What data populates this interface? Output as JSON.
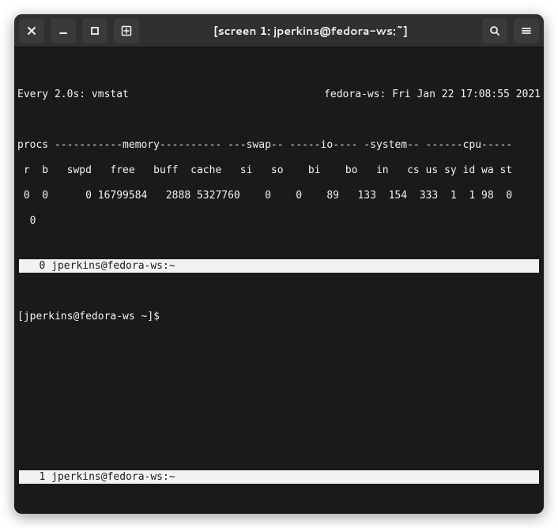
{
  "titlebar": {
    "title": "[screen 1: jperkins@fedora-ws:~]"
  },
  "top_pane": {
    "header_left": "Every 2.0s: vmstat",
    "header_right": "fedora-ws: Fri Jan 22 17:08:55 2021",
    "hdr1": "procs -----------memory---------- ---swap-- -----io---- -system-- ------cpu-----",
    "hdr2": " r  b   swpd   free   buff  cache   si   so    bi    bo   in   cs us sy id wa st",
    "row1": " 0  0      0 16799584   2888 5327760    0    0    89   133  154  333  1  1 98  0",
    "row2": "  0"
  },
  "status0": "   0 jperkins@fedora-ws:~                                                       ",
  "bottom_pane": {
    "prompt": "[jperkins@fedora-ws ~]$ "
  },
  "status1": "   1 jperkins@fedora-ws:~                                                       "
}
